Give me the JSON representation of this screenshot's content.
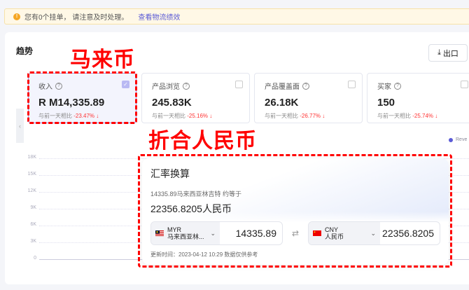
{
  "banner": {
    "text": "您有0个挂单， 请注意及时处理。",
    "link": "查看物流绩效"
  },
  "section_title": "趋势",
  "annotations": {
    "myr": "马来币",
    "cny": "折合人民币"
  },
  "export_label": "出口",
  "metrics": [
    {
      "label": "收入",
      "value": "R M14,335.89",
      "compare_label": "与前一天相比",
      "change": "-23.47%",
      "selected": true
    },
    {
      "label": "产品浏览",
      "value": "245.83K",
      "compare_label": "与前一天相比",
      "change": "-25.16%",
      "selected": false
    },
    {
      "label": "产品覆盖面",
      "value": "26.18K",
      "compare_label": "与前一天相比",
      "change": "-26.77%",
      "selected": false
    },
    {
      "label": "买家",
      "value": "150",
      "compare_label": "与前一天相比",
      "change": "-25.74%",
      "selected": false
    }
  ],
  "chart": {
    "y_ticks": [
      "18K",
      "15K",
      "12K",
      "9K",
      "6K",
      "3K",
      "0"
    ],
    "legend": "Reve"
  },
  "converter": {
    "title": "汇率换算",
    "summary": "14335.89马来西亚林吉特 约等于",
    "result": "22356.8205人民币",
    "from": {
      "code": "MYR",
      "name": "马来西亚林...",
      "amount": "14335.89"
    },
    "to": {
      "code": "CNY",
      "name": "人民币",
      "amount": "22356.8205"
    },
    "footer": "更新时间：2023-04-12 10:29 数据仅供参考"
  },
  "colors": {
    "accent": "#5b5bd6",
    "negative": "#ff3333",
    "annotation": "#ff0000"
  }
}
